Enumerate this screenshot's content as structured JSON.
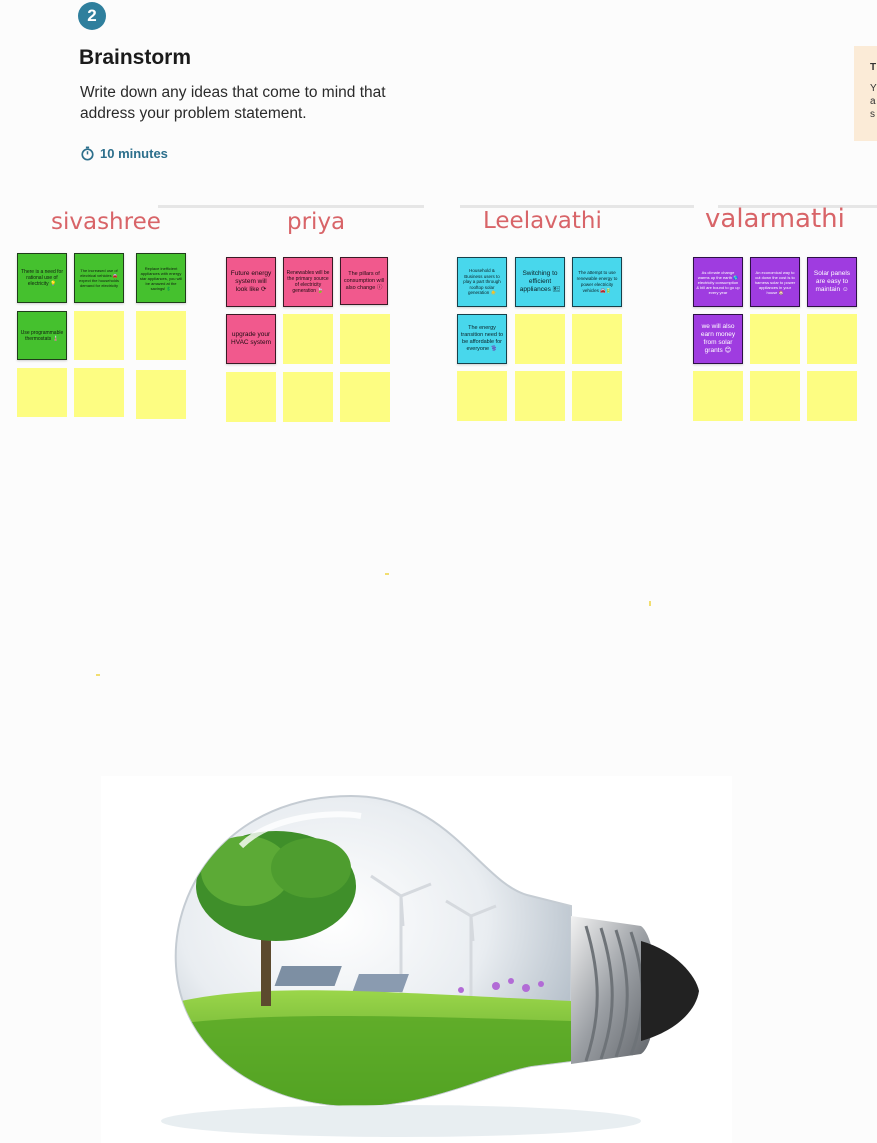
{
  "step": {
    "number": "2"
  },
  "header": {
    "title": "Brainstorm",
    "description": "Write down any ideas that come to mind that address your problem statement.",
    "timer": "10 minutes"
  },
  "tip_panel": {
    "title": "T",
    "lines": [
      "Y",
      "a",
      "s"
    ]
  },
  "participants": [
    {
      "name": "sivashree",
      "notes": [
        "There is a need for rational use of electricity 💡",
        "The increased use of electrical vehicles 🚘 expect the households demand for electricity",
        "Replace inefficient appliances with energy star appliances, you will be amazed at the savings! 💲",
        "Use programmable thermostats 🌡️"
      ]
    },
    {
      "name": "priya",
      "notes": [
        "Future energy system will look like ⟳",
        "Renewables will be the primary source of electricity generation 🍃",
        "The pillars of consumption will also change ⓘ",
        "upgrade your HVAC system"
      ]
    },
    {
      "name": "Leelavathi",
      "notes": [
        "Household & Business users to play a part through rooftop solar generation ☀️",
        "Switching to efficient appliances 🖭",
        "The attempt to use renewable energy to power electricity vehicles 🚘🔋",
        "The energy transition need to be affordable for everyone ⚕️"
      ]
    },
    {
      "name": "valarmathi",
      "notes": [
        "As climate change warms up the earth 🌎 electricity consumption & bill are bound to go up every year",
        "An economical way to cut down the cost is to harness solar to power appliances in your house 🏠",
        "Solar panels are easy to maintain ☺",
        "we will also earn money from solar grants 😊"
      ]
    }
  ],
  "colors": {
    "accent": "#2f7f9d",
    "name_text": "#d86468",
    "sticky_empty": "#fdfd82",
    "sivashree_notes": "#45c12e",
    "priya_notes": "#f1598d",
    "leelavathi_notes": "#48d7ec",
    "valarmathi_notes": "#9f3ce0"
  },
  "icons": [
    "stopwatch-icon"
  ],
  "image": {
    "subject": "lightbulb-with-green-landscape-and-wind-turbines"
  }
}
